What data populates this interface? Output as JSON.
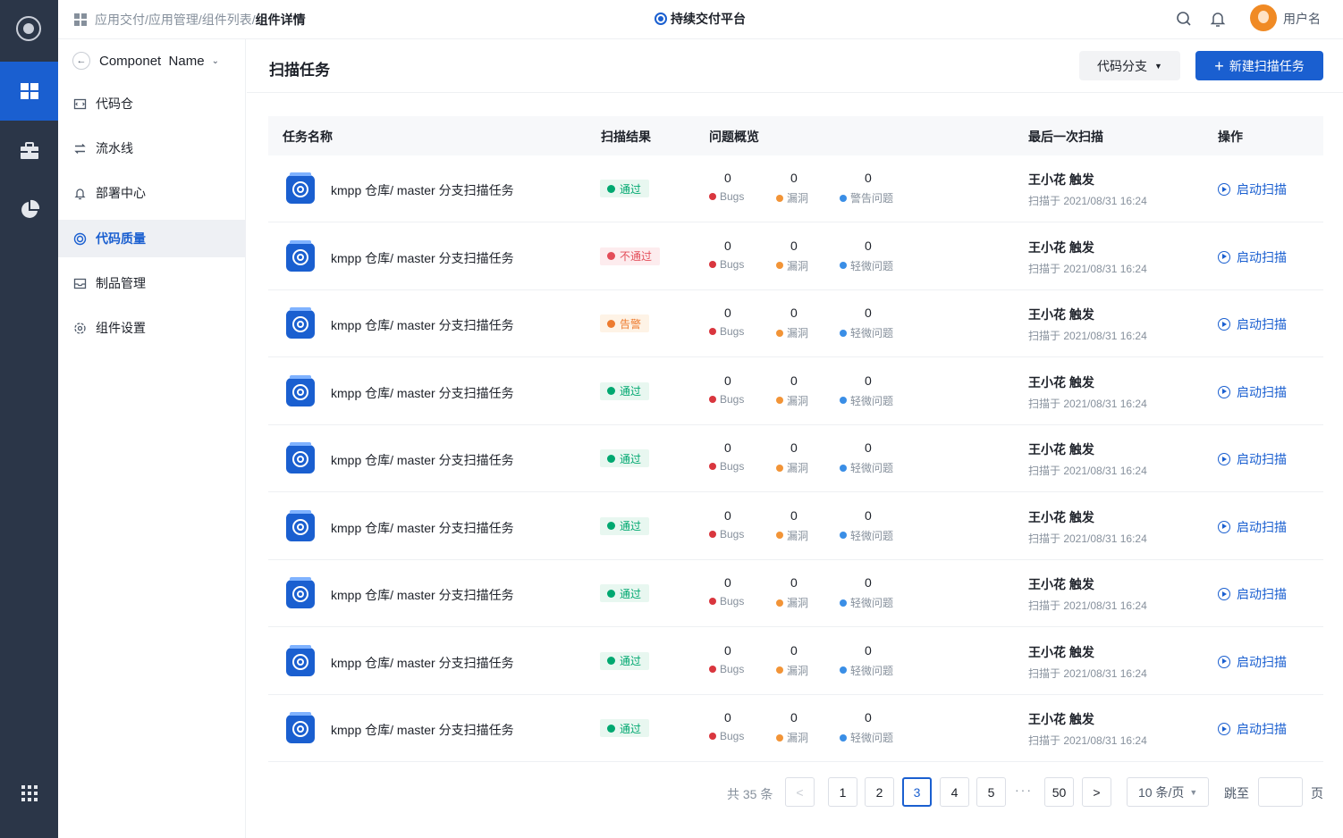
{
  "breadcrumb": {
    "path": "应用交付/应用管理/组件列表/",
    "current": "组件详情"
  },
  "platform_title": "持续交付平台",
  "user": {
    "name": "用户名"
  },
  "component": {
    "name": "Componet  Name"
  },
  "sidebar": {
    "items": [
      {
        "label": "代码仓",
        "icon": "repo-icon"
      },
      {
        "label": "流水线",
        "icon": "pipeline-icon"
      },
      {
        "label": "部署中心",
        "icon": "bell-icon"
      },
      {
        "label": "代码质量",
        "icon": "quality-icon",
        "active": true
      },
      {
        "label": "制品管理",
        "icon": "inbox-icon"
      },
      {
        "label": "组件设置",
        "icon": "gear-icon"
      }
    ]
  },
  "page": {
    "title": "扫描任务",
    "branch_button": "代码分支",
    "new_button": "新建扫描任务"
  },
  "table": {
    "headers": {
      "name": "任务名称",
      "result": "扫描结果",
      "overview": "问题概览",
      "last_scan": "最后一次扫描",
      "action": "操作"
    },
    "rows": [
      {
        "name": "kmpp 仓库/ master 分支扫描任务",
        "status": "pass",
        "status_label": "通过",
        "bugs": "0",
        "bugs_label": "Bugs",
        "vulns": "0",
        "vulns_label": "漏洞",
        "issues": "0",
        "issues_label": "警告问题",
        "trigger": "王小花 触发",
        "time": "扫描于 2021/08/31 16:24",
        "action": "启动扫描"
      },
      {
        "name": "kmpp 仓库/ master 分支扫描任务",
        "status": "fail",
        "status_label": "不通过",
        "bugs": "0",
        "bugs_label": "Bugs",
        "vulns": "0",
        "vulns_label": "漏洞",
        "issues": "0",
        "issues_label": "轻微问题",
        "trigger": "王小花 触发",
        "time": "扫描于 2021/08/31 16:24",
        "action": "启动扫描"
      },
      {
        "name": "kmpp 仓库/ master 分支扫描任务",
        "status": "warn",
        "status_label": "告警",
        "bugs": "0",
        "bugs_label": "Bugs",
        "vulns": "0",
        "vulns_label": "漏洞",
        "issues": "0",
        "issues_label": "轻微问题",
        "trigger": "王小花 触发",
        "time": "扫描于 2021/08/31 16:24",
        "action": "启动扫描"
      },
      {
        "name": "kmpp 仓库/ master 分支扫描任务",
        "status": "pass",
        "status_label": "通过",
        "bugs": "0",
        "bugs_label": "Bugs",
        "vulns": "0",
        "vulns_label": "漏洞",
        "issues": "0",
        "issues_label": "轻微问题",
        "trigger": "王小花 触发",
        "time": "扫描于 2021/08/31 16:24",
        "action": "启动扫描"
      },
      {
        "name": "kmpp 仓库/ master 分支扫描任务",
        "status": "pass",
        "status_label": "通过",
        "bugs": "0",
        "bugs_label": "Bugs",
        "vulns": "0",
        "vulns_label": "漏洞",
        "issues": "0",
        "issues_label": "轻微问题",
        "trigger": "王小花 触发",
        "time": "扫描于 2021/08/31 16:24",
        "action": "启动扫描"
      },
      {
        "name": "kmpp 仓库/ master 分支扫描任务",
        "status": "pass",
        "status_label": "通过",
        "bugs": "0",
        "bugs_label": "Bugs",
        "vulns": "0",
        "vulns_label": "漏洞",
        "issues": "0",
        "issues_label": "轻微问题",
        "trigger": "王小花 触发",
        "time": "扫描于 2021/08/31 16:24",
        "action": "启动扫描"
      },
      {
        "name": "kmpp 仓库/ master 分支扫描任务",
        "status": "pass",
        "status_label": "通过",
        "bugs": "0",
        "bugs_label": "Bugs",
        "vulns": "0",
        "vulns_label": "漏洞",
        "issues": "0",
        "issues_label": "轻微问题",
        "trigger": "王小花 触发",
        "time": "扫描于 2021/08/31 16:24",
        "action": "启动扫描"
      },
      {
        "name": "kmpp 仓库/ master 分支扫描任务",
        "status": "pass",
        "status_label": "通过",
        "bugs": "0",
        "bugs_label": "Bugs",
        "vulns": "0",
        "vulns_label": "漏洞",
        "issues": "0",
        "issues_label": "轻微问题",
        "trigger": "王小花 触发",
        "time": "扫描于 2021/08/31 16:24",
        "action": "启动扫描"
      },
      {
        "name": "kmpp 仓库/ master 分支扫描任务",
        "status": "pass",
        "status_label": "通过",
        "bugs": "0",
        "bugs_label": "Bugs",
        "vulns": "0",
        "vulns_label": "漏洞",
        "issues": "0",
        "issues_label": "轻微问题",
        "trigger": "王小花 触发",
        "time": "扫描于 2021/08/31 16:24",
        "action": "启动扫描"
      }
    ]
  },
  "pagination": {
    "total": "共 35 条",
    "prev": "<",
    "pages": [
      "1",
      "2",
      "3",
      "4",
      "5"
    ],
    "current": "3",
    "ellipsis": "···",
    "last": "50",
    "next": ">",
    "page_size": "10 条/页",
    "jump_label": "跳至",
    "jump_value": "",
    "page_label": "页"
  },
  "colors": {
    "primary": "#1a5fd0",
    "rail": "#2b3648",
    "pass": "#00a870",
    "fail": "#e34d59",
    "warn": "#ed7b2f",
    "bugs_dot": "#d9363e",
    "vulns_dot": "#f29437",
    "issues_dot": "#3a8ee6"
  }
}
